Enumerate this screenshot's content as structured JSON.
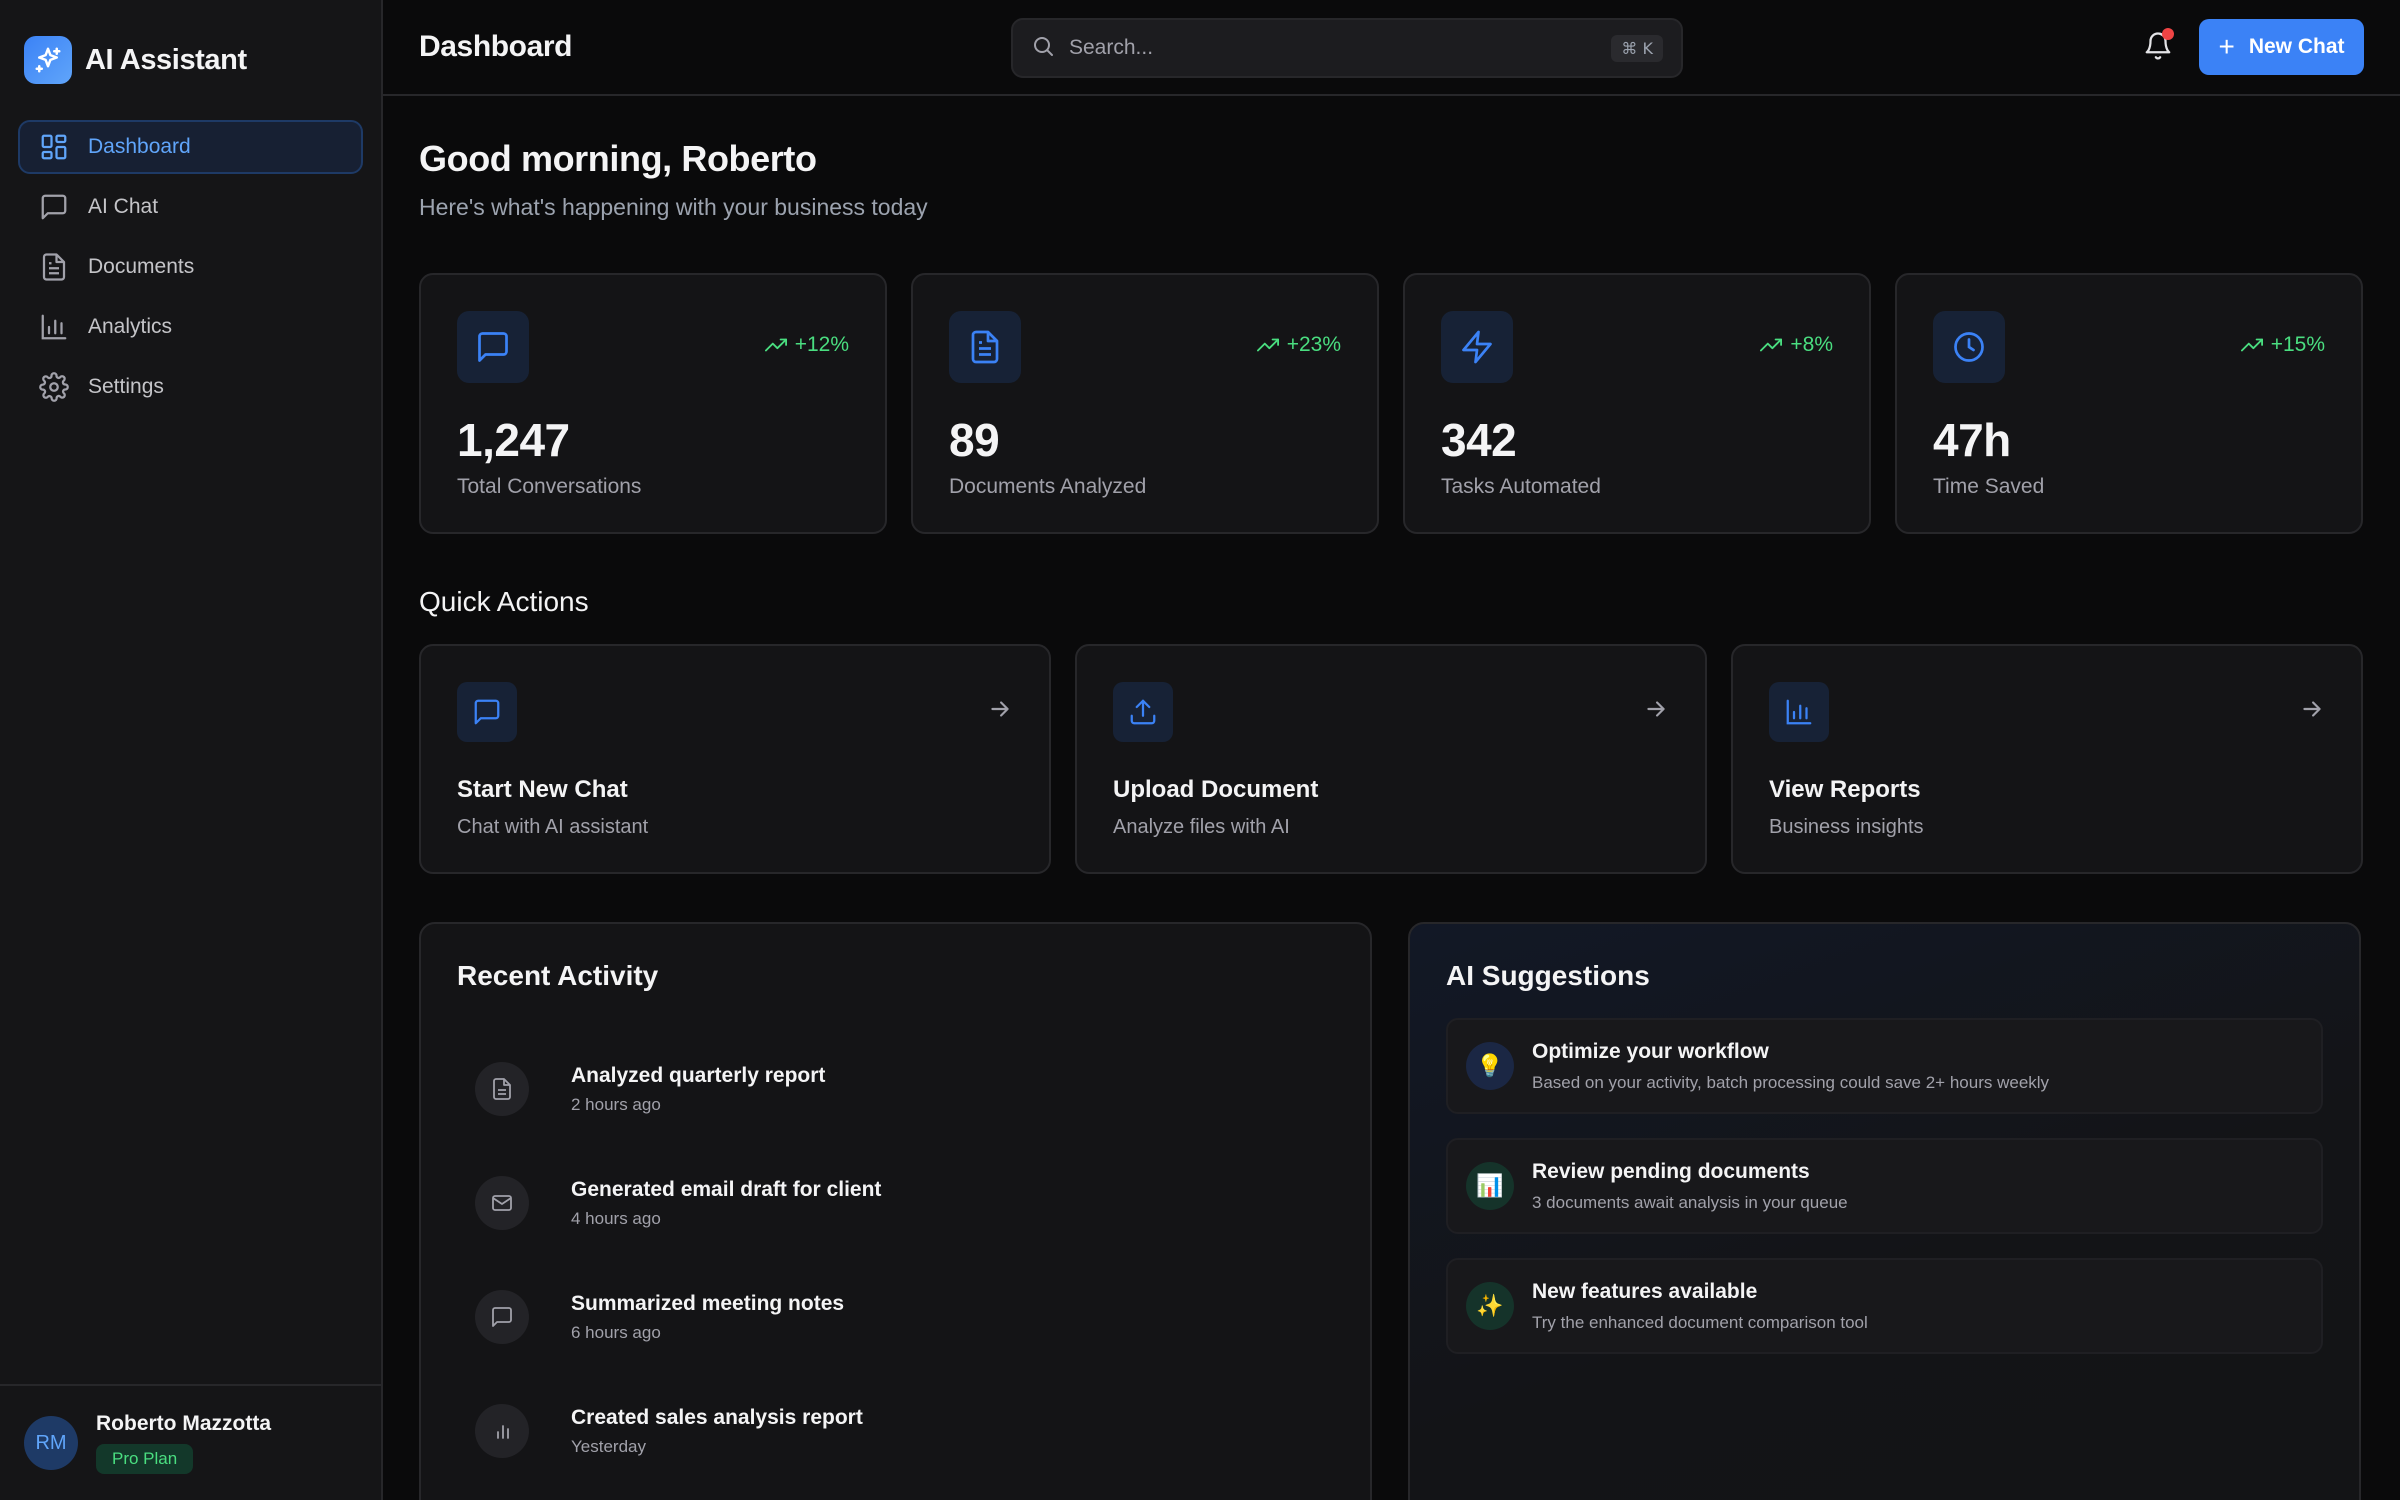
{
  "app": {
    "name": "AI Assistant"
  },
  "sidebar": {
    "items": [
      {
        "label": "Dashboard",
        "icon": "dashboard-grid-icon",
        "active": true
      },
      {
        "label": "AI Chat",
        "icon": "chat-bubble-icon"
      },
      {
        "label": "Documents",
        "icon": "document-icon"
      },
      {
        "label": "Analytics",
        "icon": "bar-chart-icon"
      },
      {
        "label": "Settings",
        "icon": "gear-icon"
      }
    ],
    "user": {
      "initials": "RM",
      "name": "Roberto Mazzotta",
      "plan": "Pro Plan"
    }
  },
  "header": {
    "title": "Dashboard",
    "search_placeholder": "Search...",
    "search_shortcut": "⌘ K",
    "new_chat_label": "New Chat",
    "notification_unread": true
  },
  "greeting": {
    "title": "Good morning, Roberto",
    "subtitle": "Here's what's happening with your business today"
  },
  "stats": [
    {
      "value": "1,247",
      "label": "Total Conversations",
      "trend": "+12%",
      "icon": "chat-bubble-icon"
    },
    {
      "value": "89",
      "label": "Documents Analyzed",
      "trend": "+23%",
      "icon": "document-icon"
    },
    {
      "value": "342",
      "label": "Tasks Automated",
      "trend": "+8%",
      "icon": "lightning-icon"
    },
    {
      "value": "47h",
      "label": "Time Saved",
      "trend": "+15%",
      "icon": "clock-icon"
    }
  ],
  "quick_actions": {
    "title": "Quick Actions",
    "items": [
      {
        "title": "Start New Chat",
        "subtitle": "Chat with AI assistant",
        "icon": "chat-bubble-icon"
      },
      {
        "title": "Upload Document",
        "subtitle": "Analyze files with AI",
        "icon": "upload-icon"
      },
      {
        "title": "View Reports",
        "subtitle": "Business insights",
        "icon": "bar-chart-icon"
      }
    ]
  },
  "recent_activity": {
    "title": "Recent Activity",
    "items": [
      {
        "title": "Analyzed quarterly report",
        "time": "2 hours ago",
        "icon": "document-icon"
      },
      {
        "title": "Generated email draft for client",
        "time": "4 hours ago",
        "icon": "mail-icon"
      },
      {
        "title": "Summarized meeting notes",
        "time": "6 hours ago",
        "icon": "chat-bubble-icon"
      },
      {
        "title": "Created sales analysis report",
        "time": "Yesterday",
        "icon": "bar-chart-icon"
      }
    ]
  },
  "ai_suggestions": {
    "title": "AI Suggestions",
    "items": [
      {
        "title": "Optimize your workflow",
        "subtitle": "Based on your activity, batch processing could save 2+ hours weekly",
        "emoji": "💡",
        "icon": "lightbulb-icon",
        "color": "#1b2744"
      },
      {
        "title": "Review pending documents",
        "subtitle": "3 documents await analysis in your queue",
        "emoji": "📊",
        "icon": "chart-emoji-icon",
        "color": "#15332a"
      },
      {
        "title": "New features available",
        "subtitle": "Try the enhanced document comparison tool",
        "emoji": "✨",
        "icon": "sparkles-icon",
        "color": "#15332a"
      }
    ]
  },
  "colors": {
    "accent": "#3b82f6",
    "accent_light": "#60a5fa",
    "positive": "#4ade80",
    "alert": "#ef4444",
    "background": "#0a0a0b",
    "sidebar": "#151517",
    "card": "#141416"
  }
}
